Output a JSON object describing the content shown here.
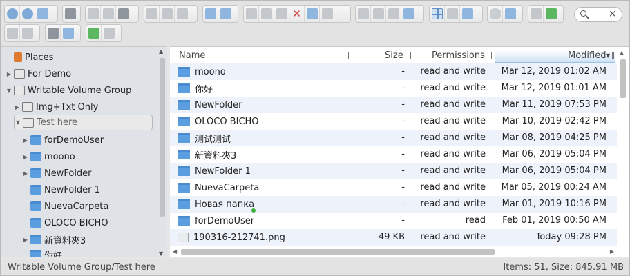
{
  "toolbar": {
    "search": {
      "placeholder": "",
      "clear_label": "×"
    }
  },
  "sidebar": {
    "items": [
      {
        "label": "Places",
        "icon": "places-icon"
      },
      {
        "label": "For Demo",
        "icon": "drive-icon"
      },
      {
        "label": "Writable Volume Group",
        "icon": "drive-icon"
      },
      {
        "label": "Img+Txt Only",
        "icon": "drive-icon"
      },
      {
        "label": "Test here",
        "icon": "drive-icon"
      },
      {
        "label": "forDemoUser",
        "icon": "folder-icon"
      },
      {
        "label": "moono",
        "icon": "folder-icon"
      },
      {
        "label": "NewFolder",
        "icon": "folder-icon"
      },
      {
        "label": "NewFolder 1",
        "icon": "folder-icon"
      },
      {
        "label": "NuevaCarpeta",
        "icon": "folder-icon"
      },
      {
        "label": "OLOCO BICHO",
        "icon": "folder-icon"
      },
      {
        "label": "新資料夾3",
        "icon": "folder-icon"
      },
      {
        "label": "你好",
        "icon": "folder-icon"
      }
    ]
  },
  "table": {
    "columns": {
      "name": "Name",
      "size": "Size",
      "permissions": "Permissions",
      "modified": "Modified"
    },
    "rows": [
      {
        "name": "moono",
        "size": "-",
        "perm": "read and write",
        "mod": "Mar 12, 2019 01:02 AM"
      },
      {
        "name": "你好",
        "size": "-",
        "perm": "read and write",
        "mod": "Mar 12, 2019 01:01 AM"
      },
      {
        "name": "NewFolder",
        "size": "-",
        "perm": "read and write",
        "mod": "Mar 11, 2019 07:53 PM"
      },
      {
        "name": "OLOCO BICHO",
        "size": "-",
        "perm": "read and write",
        "mod": "Mar 10, 2019 02:42 PM"
      },
      {
        "name": "测试测试",
        "size": "-",
        "perm": "read and write",
        "mod": "Mar 08, 2019 04:25 PM"
      },
      {
        "name": "新資料夾3",
        "size": "-",
        "perm": "read and write",
        "mod": "Mar 06, 2019 05:04 PM"
      },
      {
        "name": "NewFolder 1",
        "size": "-",
        "perm": "read and write",
        "mod": "Mar 06, 2019 05:04 PM"
      },
      {
        "name": "NuevaCarpeta",
        "size": "-",
        "perm": "read and write",
        "mod": "Mar 05, 2019 00:24 AM"
      },
      {
        "name": "Новая папка",
        "size": "-",
        "perm": "read and write",
        "mod": "Mar 01, 2019 10:16 PM"
      },
      {
        "name": "forDemoUser",
        "size": "-",
        "perm": "read",
        "mod": "Feb 01, 2019 00:50 AM"
      },
      {
        "name": "190316-212741.png",
        "size": "49 KB",
        "perm": "read and write",
        "mod": "Today 09:28 PM"
      }
    ]
  },
  "status": {
    "path": "Writable Volume Group/Test here",
    "summary": "Items: 51, Size: 845.91 MB"
  }
}
